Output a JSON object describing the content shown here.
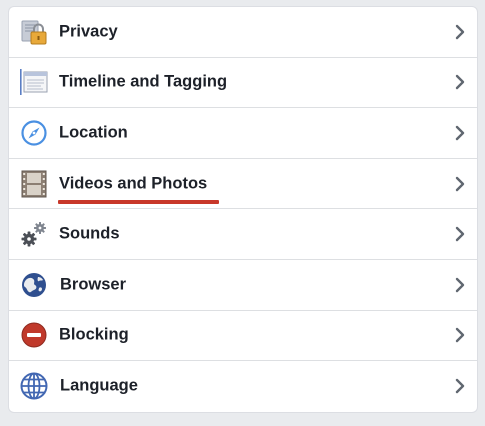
{
  "settings_list": {
    "items": [
      {
        "label": "Privacy",
        "icon": "lock-icon"
      },
      {
        "label": "Timeline and Tagging",
        "icon": "timeline-icon"
      },
      {
        "label": "Location",
        "icon": "compass-icon"
      },
      {
        "label": "Videos and Photos",
        "icon": "film-icon"
      },
      {
        "label": "Sounds",
        "icon": "gears-icon"
      },
      {
        "label": "Browser",
        "icon": "globe-icon"
      },
      {
        "label": "Blocking",
        "icon": "block-icon"
      },
      {
        "label": "Language",
        "icon": "language-globe-icon"
      }
    ],
    "highlight": {
      "item": "Videos and Photos",
      "color": "#c8382a"
    }
  },
  "colors": {
    "background": "#e9ebee",
    "text": "#1d2129",
    "divider": "#dddfe2",
    "chevron": "#606770"
  }
}
